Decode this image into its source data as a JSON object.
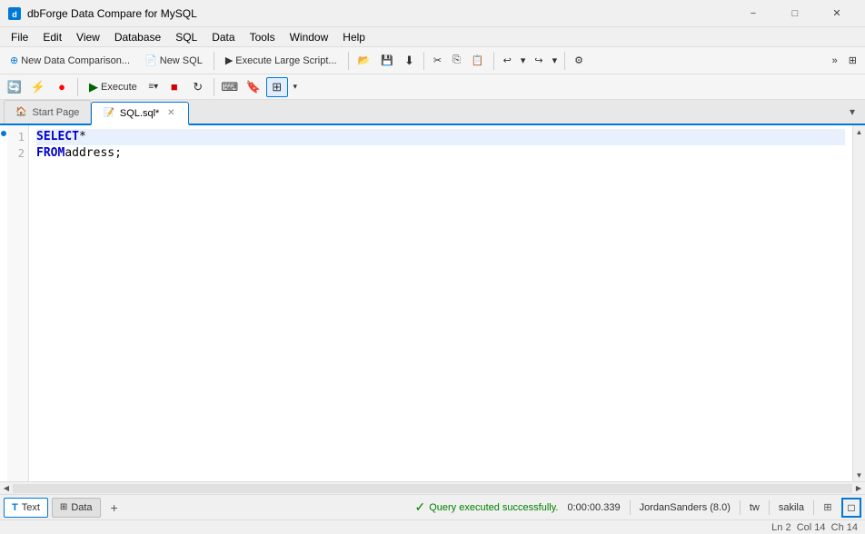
{
  "titleBar": {
    "appName": "dbForge Data Compare for MySQL",
    "btnMinimize": "−",
    "btnMaximize": "□",
    "btnClose": "✕"
  },
  "menuBar": {
    "items": [
      "File",
      "Edit",
      "View",
      "Database",
      "SQL",
      "Data",
      "Tools",
      "Window",
      "Help"
    ]
  },
  "toolbar1": {
    "newDataComparison": "New Data Comparison...",
    "newSQL": "New SQL",
    "executeLargeScript": "Execute Large Script..."
  },
  "toolbar2": {
    "execute": "Execute",
    "executeDropdown": "▾"
  },
  "tabBar": {
    "tabs": [
      {
        "label": "Start Page",
        "active": false,
        "closable": false
      },
      {
        "label": "SQL.sql*",
        "active": true,
        "closable": true
      }
    ]
  },
  "editor": {
    "lines": [
      {
        "number": "",
        "content": [
          {
            "type": "keyword",
            "text": "SELECT"
          },
          {
            "type": "plain",
            "text": " *"
          }
        ],
        "highlight": true
      },
      {
        "number": "",
        "content": [
          {
            "type": "keyword",
            "text": "FROM"
          },
          {
            "type": "plain",
            "text": " address;"
          }
        ],
        "highlight": false
      }
    ]
  },
  "statusTabs": [
    {
      "label": "Text",
      "icon": "T",
      "active": true
    },
    {
      "label": "Data",
      "icon": "grid",
      "active": false
    }
  ],
  "statusBar": {
    "successIcon": "✓",
    "successMsg": "Query executed successfully.",
    "time": "0:00:00.339",
    "user": "JordanSanders (8.0)",
    "mode": "tw",
    "db": "sakila"
  },
  "posBar": {
    "ln": "Ln 2",
    "col": "Col 14",
    "ch": "Ch 14"
  }
}
